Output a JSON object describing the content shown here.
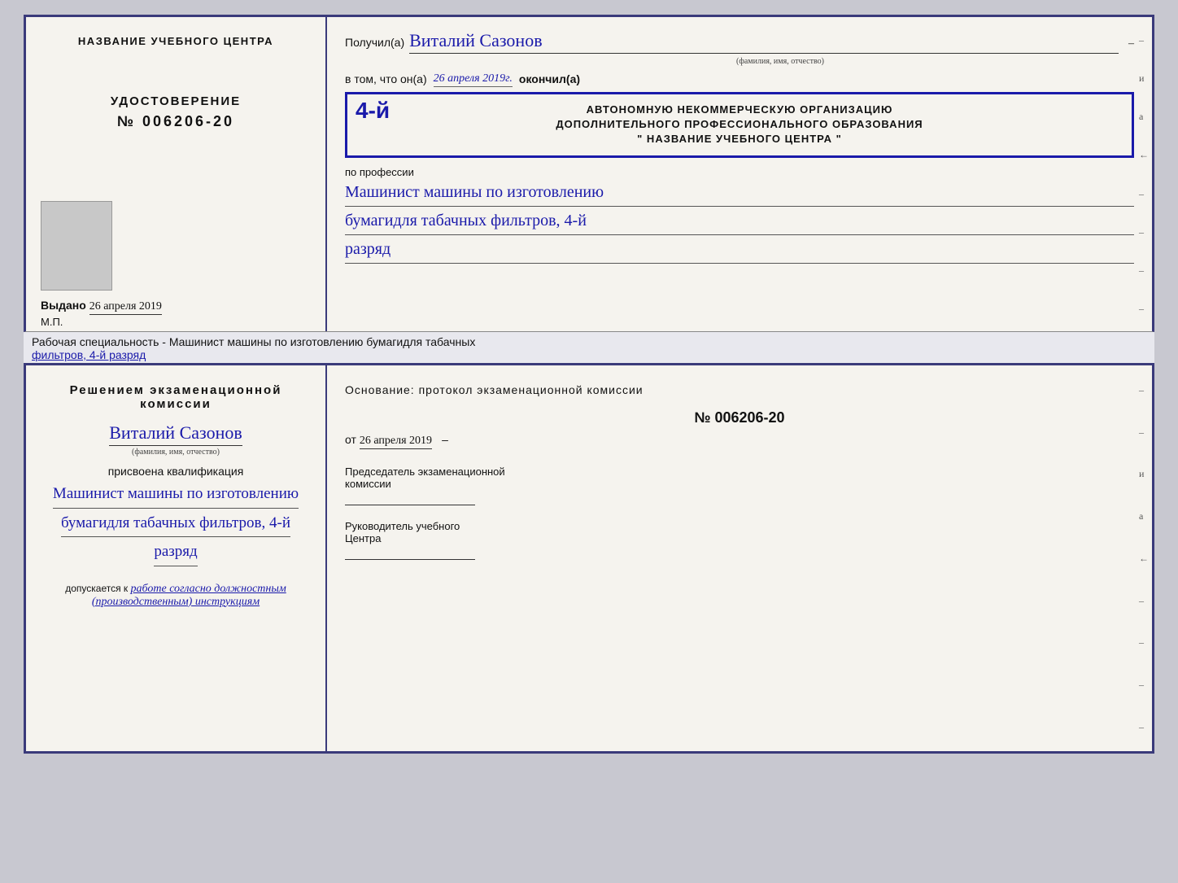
{
  "colors": {
    "accent": "#1a1aaa",
    "text": "#111111",
    "cursive": "#1a1aaa"
  },
  "top_document": {
    "left": {
      "title": "НАЗВАНИЕ УЧЕБНОГО ЦЕНТРА",
      "cert_label": "УДОСТОВЕРЕНИЕ",
      "cert_number": "№ 006206-20",
      "issued_label": "Выдано",
      "issued_date": "26 апреля 2019",
      "mp_label": "М.П."
    },
    "right": {
      "received_label": "Получил(а)",
      "received_name": "Виталий  Сазонов",
      "fio_hint": "(фамилия, имя, отчество)",
      "vtom_label": "в том, что он(а)",
      "vtom_date": "26 апреля 2019г.",
      "okoncil_label": "окончил(а)",
      "stamp_num": "4-й",
      "stamp_line1": "АВТОНОМНУЮ НЕКОММЕРЧЕСКУЮ ОРГАНИЗАЦИЮ",
      "stamp_line2": "ДОПОЛНИТЕЛЬНОГО ПРОФЕССИОНАЛЬНОГО ОБРАЗОВАНИЯ",
      "stamp_line3": "\" НАЗВАНИЕ УЧЕБНОГО ЦЕНТРА \"",
      "profession_label": "по профессии",
      "profession_line1": "Машинист машины по изготовлению",
      "profession_line2": "бумагидля табачных фильтров, 4-й",
      "profession_line3": "разряд"
    }
  },
  "separator": {
    "text_normal": "Рабочая специальность - Машинист машины по изготовлению бумагидля табачных",
    "text_underline": "фильтров, 4-й разряд"
  },
  "bottom_document": {
    "left": {
      "decision_title": "Решением  экзаменационной  комиссии",
      "person_name": "Виталий  Сазонов",
      "fio_hint": "(фамилия, имя, отчество)",
      "assigned_label": "присвоена квалификация",
      "qualification_line1": "Машинист машины по изготовлению",
      "qualification_line2": "бумагидля табачных фильтров, 4-й",
      "qualification_line3": "разряд",
      "admits_label": "допускается к",
      "admits_text": "работе согласно должностным",
      "admits_text2": "(производственным) инструкциям"
    },
    "right": {
      "osnov_label": "Основание:  протокол  экзаменационной  комиссии",
      "protocol_number": "№  006206-20",
      "ot_label": "от",
      "ot_date": "26 апреля 2019",
      "chairman_label": "Председатель экзаменационной",
      "chairman_label2": "комиссии",
      "director_label": "Руководитель учебного",
      "director_label2": "Центра"
    }
  },
  "side_marks": [
    "–",
    "и",
    "а",
    "←",
    "–",
    "–",
    "–",
    "–"
  ],
  "side_marks_bottom": [
    "–",
    "–",
    "и",
    "а",
    "←",
    "–",
    "–",
    "–",
    "–"
  ]
}
